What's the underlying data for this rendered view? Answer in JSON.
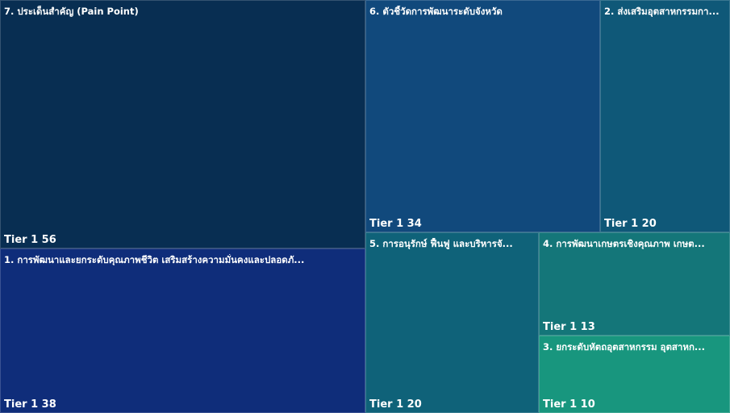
{
  "chart_data": {
    "type": "treemap",
    "items": [
      {
        "label": "7. ประเด็นสำคัญ (Pain Point)",
        "group": "Tier 1",
        "value": 56,
        "color": "#082e52"
      },
      {
        "label": "1. การพัฒนาและยกระดับคุณภาพชีวิต เสริมสร้างความมั่นคงและปลอดภั...",
        "group": "Tier 1",
        "value": 38,
        "color": "#0f2d7a"
      },
      {
        "label": "6. ตัวชี้วัดการพัฒนาระดับจังหวัด",
        "group": "Tier 1",
        "value": 34,
        "color": "#11497c"
      },
      {
        "label": "2. ส่งเสริมอุตสาหกรรมกา...",
        "group": "Tier 1",
        "value": 20,
        "color": "#0f5878"
      },
      {
        "label": "5. การอนุรักษ์ ฟื้นฟู และบริหารจั...",
        "group": "Tier 1",
        "value": 20,
        "color": "#0f6279"
      },
      {
        "label": "4. การพัฒนาเกษตรเชิงคุณภาพ เกษต...",
        "group": "Tier 1",
        "value": 13,
        "color": "#147679"
      },
      {
        "label": "3. ยกระดับหัตถอุตสาหกรรม อุตสาหก...",
        "group": "Tier 1",
        "value": 10,
        "color": "#18967e"
      }
    ]
  }
}
